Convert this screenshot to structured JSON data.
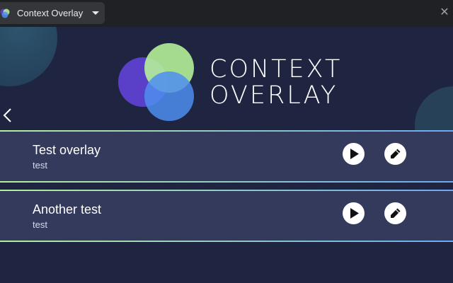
{
  "tab": {
    "title": "Context Overlay",
    "icon": "app-logo-icon",
    "menu_icon": "caret-down-icon"
  },
  "window": {
    "close_glyph": "✕",
    "close_icon": "close-icon"
  },
  "header": {
    "logo_line1": "CONTEXT",
    "logo_line2": "OVERLAY",
    "back_icon": "chevron-left-icon"
  },
  "colors": {
    "background": "#1f2541",
    "row_background": "#343a5c",
    "circle_purple": "#5a3fc9",
    "circle_green": "#b7f59a",
    "circle_blue": "#4f8ef0",
    "divider_start": "#b4ef9a",
    "divider_end": "#6da8f2"
  },
  "overlays": [
    {
      "title": "Test overlay",
      "description": "test",
      "play_icon": "play-icon",
      "edit_icon": "pencil-icon"
    },
    {
      "title": "Another test",
      "description": "test",
      "play_icon": "play-icon",
      "edit_icon": "pencil-icon"
    }
  ]
}
